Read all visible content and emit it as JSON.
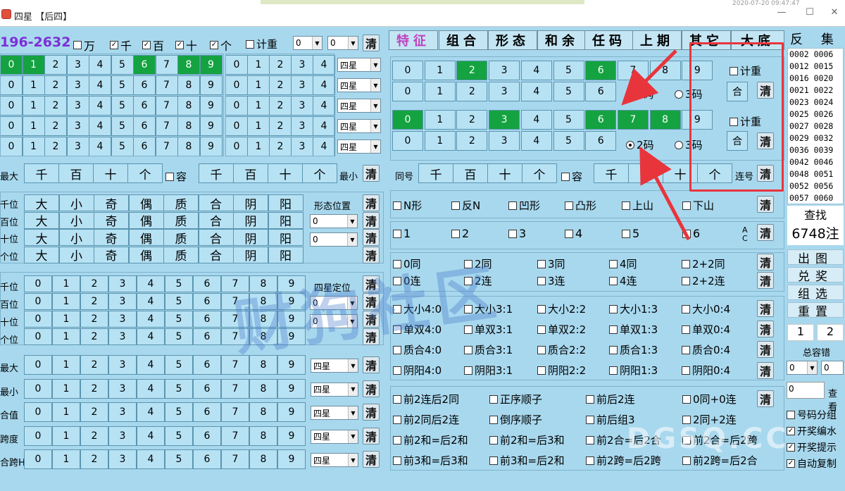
{
  "window": {
    "title": "四星 【后四】",
    "clock": "2020-07-20 09:47:47",
    "min": "—",
    "max": "☐",
    "close": "✕"
  },
  "top": {
    "range": "196-2632",
    "positions": [
      "万",
      "千",
      "百",
      "十",
      "个"
    ],
    "pos_checked": [
      false,
      true,
      true,
      true,
      true
    ],
    "jizhong": "计重",
    "sel1": "0",
    "sel2": "0",
    "clear": "清"
  },
  "grid_digits": [
    "0",
    "1",
    "2",
    "3",
    "4",
    "5",
    "6",
    "7",
    "8",
    "9"
  ],
  "grid_small": [
    "0",
    "1",
    "2",
    "3",
    "4"
  ],
  "grid_sel": [
    [
      0,
      1,
      6,
      8,
      9
    ],
    [],
    [],
    [],
    []
  ],
  "grid_mode": "四星",
  "maxmin": {
    "max_label": "最大",
    "min_label": "最小",
    "cols": [
      "千",
      "百",
      "十",
      "个"
    ],
    "rong": "容"
  },
  "shape": {
    "rows": [
      "千位",
      "百位",
      "十位",
      "个位"
    ],
    "items": [
      "大",
      "小",
      "奇",
      "偶",
      "质",
      "合",
      "阴",
      "阳"
    ],
    "pos_label": "形态位置",
    "sel": "0"
  },
  "dingwei": {
    "rows": [
      "千位",
      "百位",
      "十位",
      "个位"
    ],
    "label": "四星定位",
    "sel": "0"
  },
  "stats": {
    "rows": [
      "最大",
      "最小",
      "合值",
      "跨度",
      "合跨H"
    ],
    "mode": "四星"
  },
  "tabs": [
    "特征",
    "组合",
    "形态",
    "和余",
    "任码",
    "上期",
    "其它",
    "大底"
  ],
  "feat_row1": {
    "selected": [
      2,
      6
    ]
  },
  "feat_row1b": [
    "0",
    "1",
    "2",
    "3",
    "4",
    "5",
    "6"
  ],
  "feat_row2": {
    "selected": [
      0,
      3,
      6,
      7,
      8
    ]
  },
  "radio": {
    "r2": "2码",
    "r3": "3码"
  },
  "he": "合",
  "tonghao": {
    "label": "同号",
    "cols": [
      "千",
      "百",
      "十",
      "个"
    ],
    "rong": "容",
    "lianhao": "连号"
  },
  "shape_chk": [
    "N形",
    "反N",
    "凹形",
    "凸形",
    "上山",
    "下山"
  ],
  "num_chk": [
    "1",
    "2",
    "3",
    "4",
    "5",
    "6"
  ],
  "ac": "A\nC",
  "tong_chk": [
    [
      "0同",
      "2同",
      "3同",
      "4同",
      "2+2同"
    ],
    [
      "0连",
      "2连",
      "3连",
      "4连",
      "2+2连"
    ]
  ],
  "ratio_chk": [
    [
      "大小4:0",
      "大小3:1",
      "大小2:2",
      "大小1:3",
      "大小0:4"
    ],
    [
      "单双4:0",
      "单双3:1",
      "单双2:2",
      "单双1:3",
      "单双0:4"
    ],
    [
      "质合4:0",
      "质合3:1",
      "质合2:2",
      "质合1:3",
      "质合0:4"
    ],
    [
      "阴阳4:0",
      "阴阳3:1",
      "阴阳2:2",
      "阴阳1:3",
      "阴阳0:4"
    ]
  ],
  "misc_chk": [
    [
      "前2连后2同",
      "正序顺子",
      "前后2连",
      "0同+0连"
    ],
    [
      "前2同后2连",
      "倒序顺子",
      "前后组3",
      "2同+2连"
    ],
    [
      "前2和=后2和",
      "前2和=后3和",
      "前2合=后2合",
      "前2合=后2跨"
    ],
    [
      "前3和=后3和",
      "前3和=后2和",
      "前2跨=后2跨",
      "前2跨=后2合"
    ]
  ],
  "side": {
    "title": "反  集",
    "codes": [
      [
        "0002",
        "0006"
      ],
      [
        "0012",
        "0015"
      ],
      [
        "0016",
        "0020"
      ],
      [
        "0021",
        "0022"
      ],
      [
        "0023",
        "0024"
      ],
      [
        "0025",
        "0026"
      ],
      [
        "0027",
        "0028"
      ],
      [
        "0029",
        "0032"
      ],
      [
        "0036",
        "0039"
      ],
      [
        "0042",
        "0046"
      ],
      [
        "0048",
        "0051"
      ],
      [
        "0052",
        "0056"
      ],
      [
        "0057",
        "0060"
      ]
    ],
    "find": "查找",
    "count": "6748注",
    "btns": [
      "出图",
      "兑奖",
      "组选",
      "重置"
    ],
    "tab1": "1",
    "tab2": "2",
    "rongcuo": "总容错",
    "sel": "0",
    "input": "0",
    "chakan": "查看",
    "options": [
      {
        "label": "号码分组",
        "checked": false
      },
      {
        "label": "开奖编水",
        "checked": true
      },
      {
        "label": "开奖提示",
        "checked": true
      },
      {
        "label": "自动复制",
        "checked": true
      }
    ]
  },
  "watermark": "财狗社区",
  "watermark_url": "DGSQ.CC",
  "colors": {
    "bg": "#a8d8ee",
    "cell": "#b7e2f4",
    "selected": "#14a340",
    "range_text": "#7b2fd6",
    "annotation": "#e8353c"
  }
}
